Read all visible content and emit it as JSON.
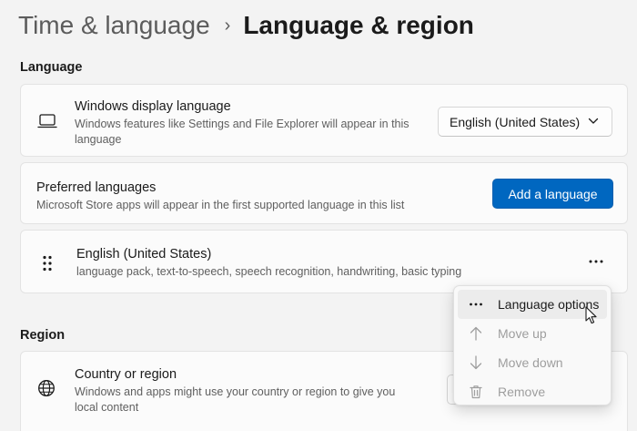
{
  "header": {
    "parent": "Time & language",
    "separator": "›",
    "current": "Language & region"
  },
  "language_section": {
    "title": "Language",
    "display_language": {
      "icon": "laptop-icon",
      "title": "Windows display language",
      "description": "Windows features like Settings and File Explorer will appear in this language",
      "dropdown_value": "English (United States)"
    },
    "preferred_languages": {
      "title": "Preferred languages",
      "description": "Microsoft Store apps will appear in the first supported language in this list",
      "add_button": "Add a language"
    },
    "language_item": {
      "icon": "drag-handle-icon",
      "title": "English (United States)",
      "description": "language pack, text-to-speech, speech recognition, handwriting, basic typing"
    }
  },
  "region_section": {
    "title": "Region",
    "country": {
      "icon": "globe-icon",
      "title": "Country or region",
      "description": "Windows and apps might use your country or region to give you local content"
    }
  },
  "context_menu": {
    "items": [
      {
        "label": "Language options",
        "icon": "more-icon",
        "enabled": true
      },
      {
        "label": "Move up",
        "icon": "arrow-up-icon",
        "enabled": false
      },
      {
        "label": "Move down",
        "icon": "arrow-down-icon",
        "enabled": false
      },
      {
        "label": "Remove",
        "icon": "trash-icon",
        "enabled": false
      }
    ]
  },
  "colors": {
    "accent": "#0067c0",
    "background": "#f3f3f3",
    "card": "#fbfbfb"
  }
}
